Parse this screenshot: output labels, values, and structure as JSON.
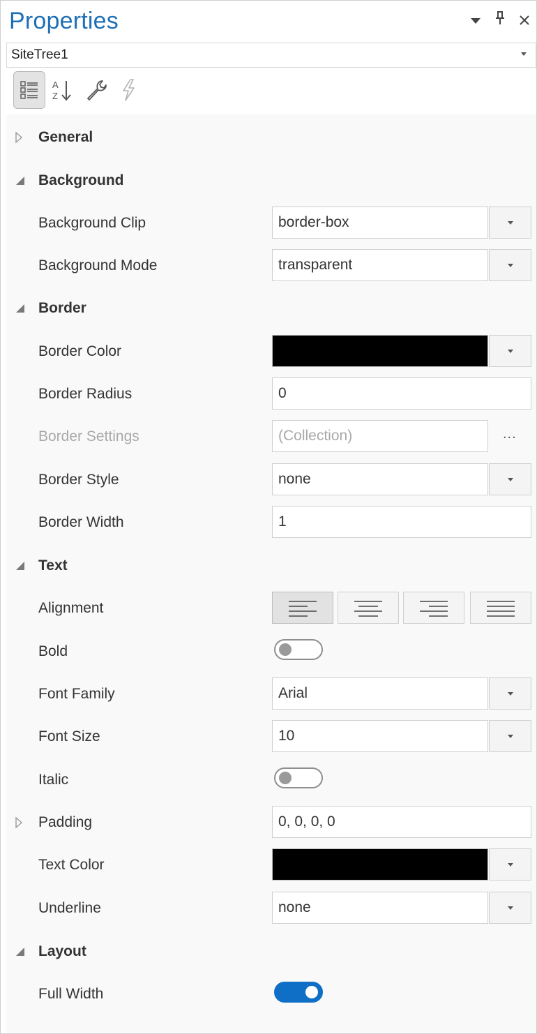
{
  "panel": {
    "title": "Properties",
    "icons": {
      "dropdown": "chevron-down-icon",
      "pin": "pin-icon",
      "close": "close-icon"
    }
  },
  "object_selector": {
    "value": "SiteTree1"
  },
  "toolbar": {
    "buttons": [
      "categorized-icon",
      "sort-alphabetical-icon",
      "wrench-icon",
      "lightning-icon"
    ]
  },
  "categories": {
    "general": {
      "label": "General",
      "expanded": false
    },
    "background": {
      "label": "Background",
      "expanded": true
    },
    "border": {
      "label": "Border",
      "expanded": true
    },
    "text": {
      "label": "Text",
      "expanded": true
    },
    "layout": {
      "label": "Layout",
      "expanded": true
    }
  },
  "properties": {
    "background_clip": {
      "label": "Background Clip",
      "value": "border-box"
    },
    "background_mode": {
      "label": "Background Mode",
      "value": "transparent"
    },
    "border_color": {
      "label": "Border Color",
      "color": "#000000"
    },
    "border_radius": {
      "label": "Border Radius",
      "value": "0"
    },
    "border_settings": {
      "label": "Border Settings",
      "value": "(Collection)",
      "button": "..."
    },
    "border_style": {
      "label": "Border Style",
      "value": "none"
    },
    "border_width": {
      "label": "Border Width",
      "value": "1"
    },
    "alignment": {
      "label": "Alignment",
      "options": [
        "left",
        "center",
        "right",
        "justify"
      ],
      "selected": "left"
    },
    "bold": {
      "label": "Bold",
      "on": false
    },
    "font_family": {
      "label": "Font Family",
      "value": "Arial"
    },
    "font_size": {
      "label": "Font Size",
      "value": "10"
    },
    "italic": {
      "label": "Italic",
      "on": false
    },
    "padding": {
      "label": "Padding",
      "value": "0, 0, 0, 0"
    },
    "text_color": {
      "label": "Text Color",
      "color": "#000000"
    },
    "underline": {
      "label": "Underline",
      "value": "none"
    },
    "full_width": {
      "label": "Full Width",
      "on": true
    }
  },
  "colors": {
    "title": "#1e6fb5",
    "toggle_on": "#0f6fc6",
    "grid_bg": "#f9f9f9"
  }
}
